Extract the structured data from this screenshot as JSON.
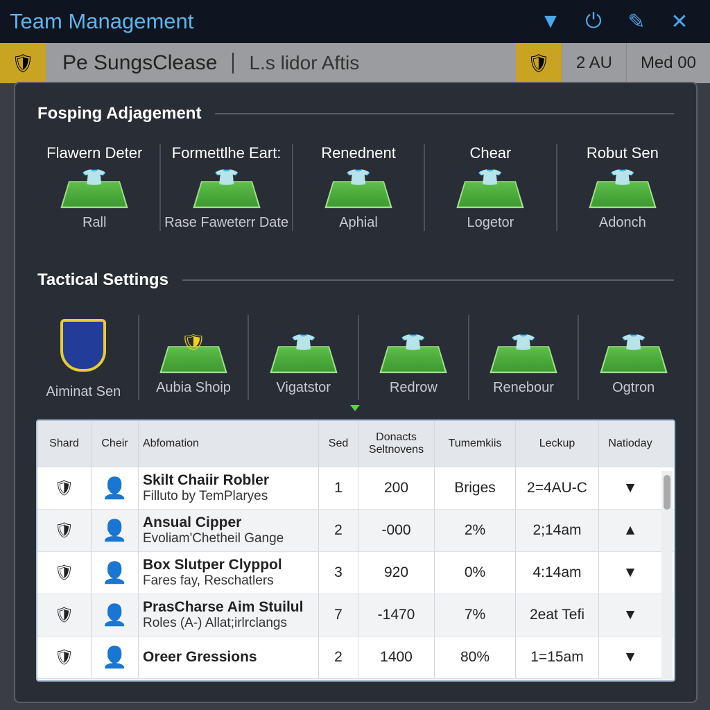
{
  "window": {
    "title": "Team Management"
  },
  "background": {
    "title": "Pe SungsClease",
    "subtitle": "L.s lidor Aftis",
    "cell1": "2 AU",
    "cell2": "Med  00"
  },
  "section1": {
    "title": "Fosping Adjagement",
    "cards": [
      {
        "title": "Flawern Deter",
        "label": "Rall"
      },
      {
        "title": "Formettlhe Eart:",
        "label": "Rase Faweterr Date"
      },
      {
        "title": "Renednent",
        "label": "Aphial"
      },
      {
        "title": "Chear",
        "label": "Logetor"
      },
      {
        "title": "Robut Sen",
        "label": "Adonch"
      }
    ]
  },
  "section2": {
    "title": "Tactical Settings",
    "cards": [
      {
        "label": "Aiminat Sen",
        "kind": "badge"
      },
      {
        "label": "Aubia Shoip",
        "kind": "pitch-badge"
      },
      {
        "label": "Vigatstor",
        "kind": "pitch"
      },
      {
        "label": "Redrow",
        "kind": "pitch"
      },
      {
        "label": "Renebour",
        "kind": "pitch"
      },
      {
        "label": "Ogtron",
        "kind": "pitch"
      }
    ]
  },
  "table": {
    "headers": [
      "Shard",
      "Cheir",
      "Abfomation",
      "Sed",
      "Donacts Seltnovens",
      "Tumemkiis",
      "Leckup",
      "Natioday"
    ],
    "rows": [
      {
        "name": "Skilt Chaiir Robler",
        "sub": "Filluto by TemPlaryes",
        "sed": "1",
        "donacts": "200",
        "tumemkiis": "Briges",
        "leckup": "2=4AU-C",
        "arrow": "▼"
      },
      {
        "name": "Ansual Cipper",
        "sub": "Evoliam'Chetheil Gange",
        "sed": "2",
        "donacts": "-000",
        "tumemkiis": "2%",
        "leckup": "2;14am",
        "arrow": "▲"
      },
      {
        "name": "Box Slutper Clyppol",
        "sub": "Fares fay, Reschatlers",
        "sed": "3",
        "donacts": "920",
        "tumemkiis": "0%",
        "leckup": "4:14am",
        "arrow": "▼"
      },
      {
        "name": "PrasCharse Aim Stuilul",
        "sub": "Roles (A-) Allat;irlrclangs",
        "sed": "7",
        "donacts": "-1470",
        "tumemkiis": "7%",
        "leckup": "2eat Tefi",
        "arrow": "▼"
      },
      {
        "name": "Oreer Gressions",
        "sub": "",
        "sed": "2",
        "donacts": "1400",
        "tumemkiis": "80%",
        "leckup": "1=15am",
        "arrow": "▼"
      }
    ]
  }
}
